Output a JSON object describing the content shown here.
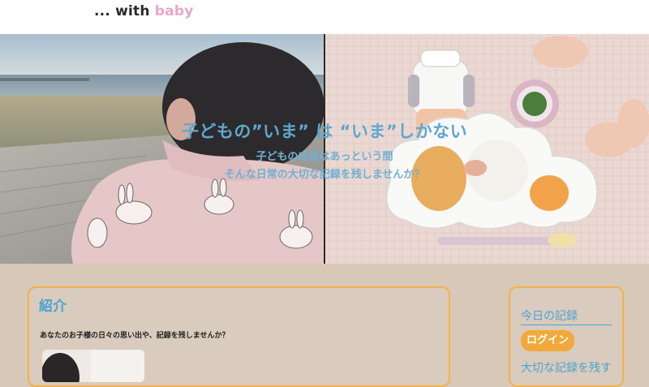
{
  "header": {
    "logo_dots": "...",
    "logo_with": "with",
    "logo_baby": "baby"
  },
  "hero": {
    "title": "子どもの”いま” は “いま”しかない",
    "subtitle_line1": "子どもの成長はあっという間",
    "subtitle_line2": "そんな日常の大切な記録を残しませんか？"
  },
  "main_card": {
    "heading": "紹介",
    "intro_text": "あなたのお子様の日々の思い出や、記録を残しませんか？"
  },
  "sidebar": {
    "title": "今日の記録",
    "login_label": "ログイン",
    "link_label": "大切な記録を残す"
  },
  "colors": {
    "page_bg": "#d7c8b8",
    "accent_blue": "#4ba3d4",
    "accent_orange": "#f3b24a",
    "baby_pink": "#e9a7c9"
  }
}
